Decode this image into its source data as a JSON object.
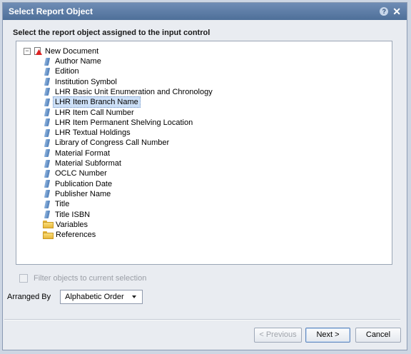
{
  "dialog": {
    "title": "Select Report Object",
    "help_glyph": "?",
    "close_glyph": "✕",
    "prompt": "Select the report object assigned to the input control"
  },
  "tree": {
    "root": {
      "label": "New Document",
      "expanded": true,
      "toggle_glyph": "−",
      "icon": "document-icon"
    },
    "items": [
      {
        "label": "Author Name",
        "icon": "dimension-icon"
      },
      {
        "label": "Edition",
        "icon": "dimension-icon"
      },
      {
        "label": "Institution Symbol",
        "icon": "dimension-icon"
      },
      {
        "label": "LHR Basic Unit Enumeration and Chronology",
        "icon": "dimension-icon"
      },
      {
        "label": "LHR Item Branch Name",
        "icon": "dimension-icon",
        "selected": true
      },
      {
        "label": "LHR Item Call Number",
        "icon": "dimension-icon"
      },
      {
        "label": "LHR Item Permanent Shelving Location",
        "icon": "dimension-icon"
      },
      {
        "label": "LHR Textual Holdings",
        "icon": "dimension-icon"
      },
      {
        "label": "Library of Congress Call Number",
        "icon": "dimension-icon"
      },
      {
        "label": "Material Format",
        "icon": "dimension-icon"
      },
      {
        "label": "Material Subformat",
        "icon": "dimension-icon"
      },
      {
        "label": "OCLC Number",
        "icon": "dimension-icon"
      },
      {
        "label": "Publication Date",
        "icon": "dimension-icon"
      },
      {
        "label": "Publisher Name",
        "icon": "dimension-icon"
      },
      {
        "label": "Title",
        "icon": "dimension-icon"
      },
      {
        "label": "Title ISBN",
        "icon": "dimension-icon"
      },
      {
        "label": "Variables",
        "icon": "folder-icon"
      },
      {
        "label": "References",
        "icon": "folder-icon"
      }
    ]
  },
  "filter": {
    "label": "Filter objects to current selection",
    "checked": false,
    "enabled": false
  },
  "arranged": {
    "label": "Arranged By",
    "value": "Alphabetic Order"
  },
  "buttons": {
    "previous": "< Previous",
    "next": "Next >",
    "cancel": "Cancel"
  },
  "colors": {
    "titlebar": "#5a7aa5",
    "selection": "#cde0f7",
    "dialog_bg": "#e9ecf1"
  }
}
